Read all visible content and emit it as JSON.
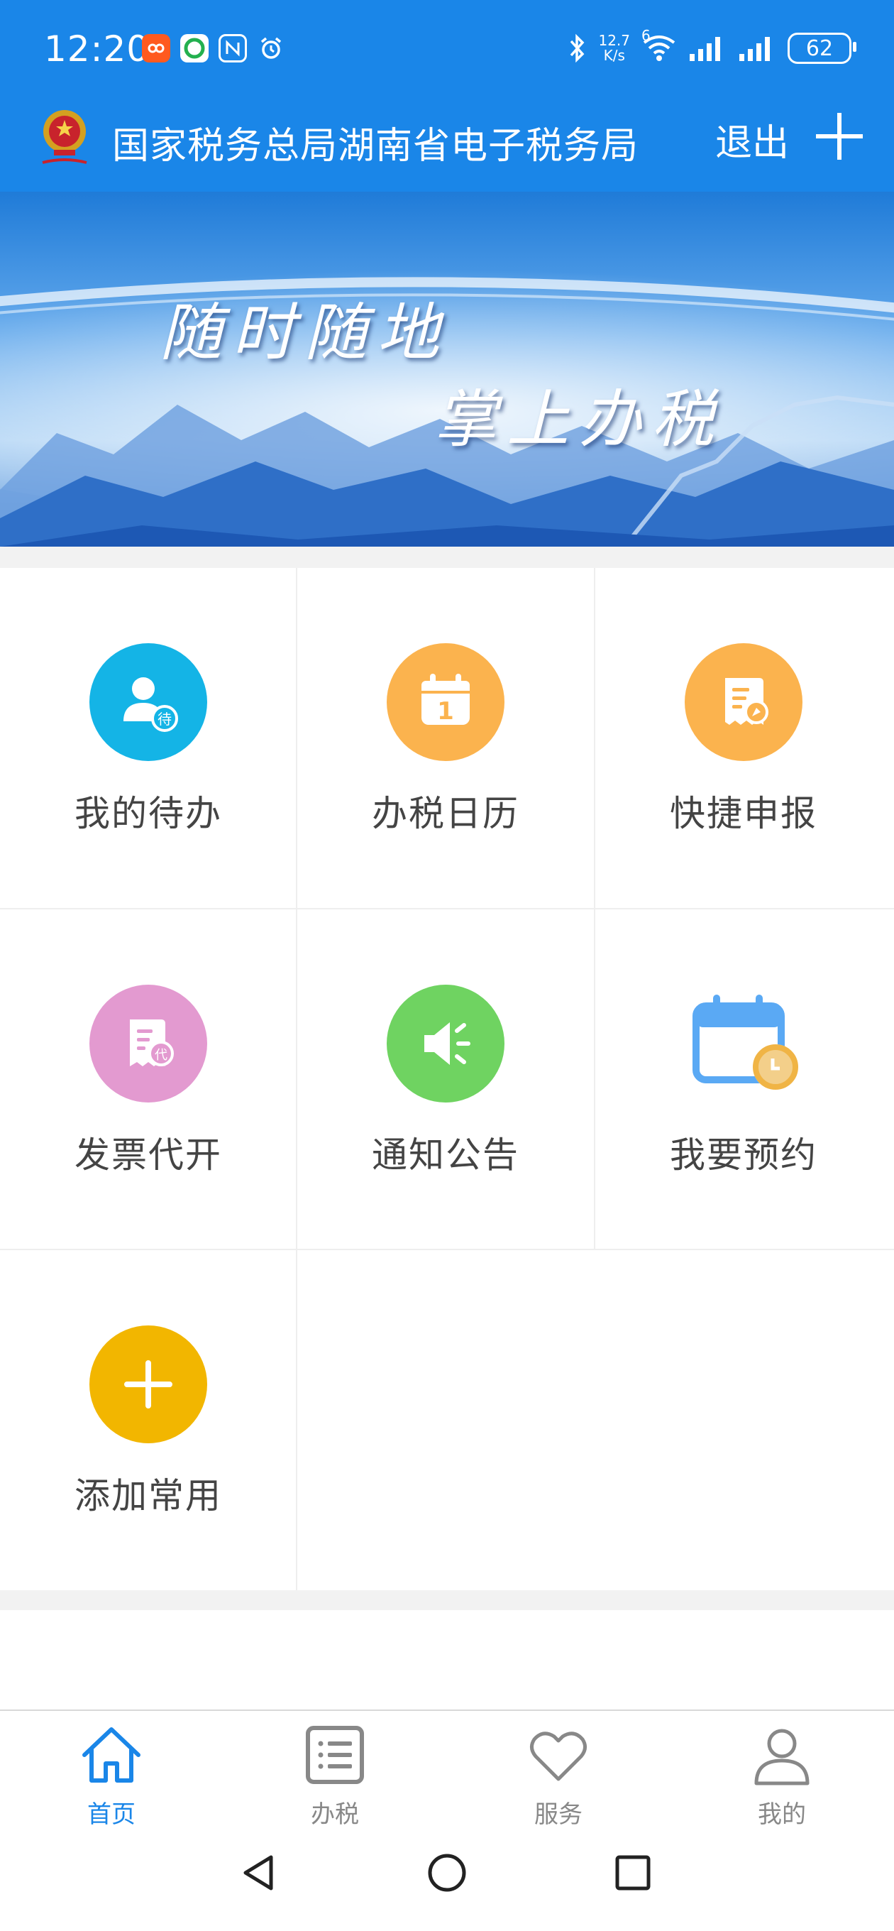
{
  "status_bar": {
    "time": "12:20",
    "speed_value": "12.7",
    "speed_unit": "K/s",
    "network_tag": "6",
    "battery": "62"
  },
  "header": {
    "title": "国家税务总局湖南省电子税务局",
    "logout_label": "退出"
  },
  "banner": {
    "line1": "随时随地",
    "line2": "掌上办税"
  },
  "grid": {
    "items": [
      {
        "label": "我的待办",
        "badge": "待",
        "color": "#14b4e6",
        "icon": "todo-person-icon"
      },
      {
        "label": "办税日历",
        "badge": "1",
        "color": "#fbb34e",
        "icon": "calendar-icon"
      },
      {
        "label": "快捷申报",
        "color": "#fbb34e",
        "icon": "quick-declare-icon"
      },
      {
        "label": "发票代开",
        "badge": "代",
        "color": "#e39ad0",
        "icon": "invoice-icon"
      },
      {
        "label": "通知公告",
        "color": "#6fd361",
        "icon": "speaker-icon"
      },
      {
        "label": "我要预约",
        "color": "#5aa9f4",
        "icon": "appointment-calendar-icon"
      },
      {
        "label": "添加常用",
        "color": "#f2b600",
        "icon": "plus-icon"
      }
    ]
  },
  "bottom_nav": {
    "active_color": "#1a86e8",
    "inactive_color": "#888888",
    "items": [
      {
        "label": "首页",
        "icon": "home-icon",
        "active": true
      },
      {
        "label": "办税",
        "icon": "list-icon",
        "active": false
      },
      {
        "label": "服务",
        "icon": "heart-icon",
        "active": false
      },
      {
        "label": "我的",
        "icon": "user-icon",
        "active": false
      }
    ]
  }
}
